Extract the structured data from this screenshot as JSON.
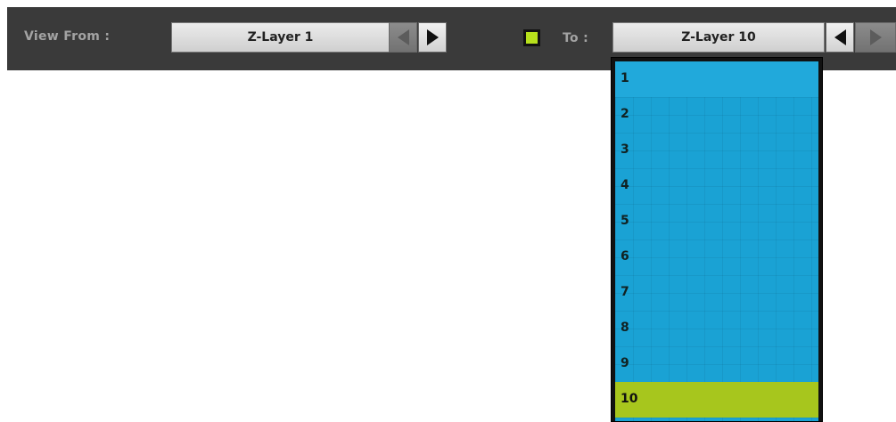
{
  "toolbar": {
    "view_from_label": "View From :",
    "from_value": "Z-Layer 1",
    "to_label": "To :",
    "to_value": "Z-Layer 10",
    "toggle_color": "#b7e01c"
  },
  "dropdown": {
    "options": [
      "1",
      "2",
      "3",
      "4",
      "5",
      "6",
      "7",
      "8",
      "9",
      "10"
    ],
    "selected": "10",
    "colors": {
      "list_background": "#1aa2d4",
      "selected_background": "#a7c61d"
    }
  },
  "icons": {
    "prev": "triangle-left-icon",
    "next": "triangle-right-icon"
  }
}
